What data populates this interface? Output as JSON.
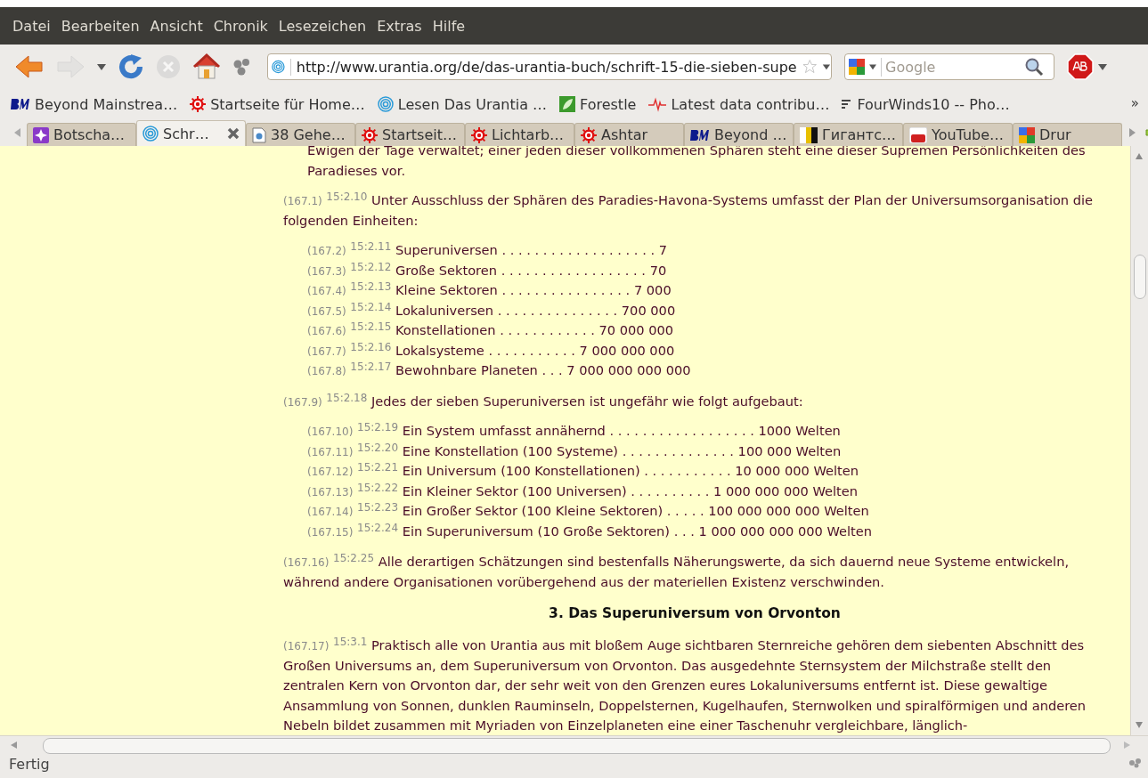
{
  "menu": [
    {
      "label": "Datei"
    },
    {
      "label": "Bearbeiten"
    },
    {
      "label": "Ansicht"
    },
    {
      "label": "Chronik"
    },
    {
      "label": "Lesezeichen"
    },
    {
      "label": "Extras"
    },
    {
      "label": "Hilfe"
    }
  ],
  "nav_buttons": [
    {
      "kind": "back",
      "disabled": false
    },
    {
      "kind": "forward",
      "disabled": true
    },
    {
      "kind": "history",
      "disabled": false
    },
    {
      "kind": "reload",
      "disabled": false
    },
    {
      "kind": "stop",
      "disabled": true
    },
    {
      "kind": "home",
      "disabled": false
    },
    {
      "kind": "addon",
      "disabled": false
    }
  ],
  "address_bar": {
    "value": "http://www.urantia.org/de/das-urantia-buch/schrift-15-die-sieben-supe"
  },
  "search": {
    "placeholder": "Google"
  },
  "bookmarks": [
    {
      "label": "Beyond Mainstrea…"
    },
    {
      "label": "Startseite für Home…"
    },
    {
      "label": "Lesen Das Urantia …"
    },
    {
      "label": "Forestle"
    },
    {
      "label": "Latest data contribu…"
    },
    {
      "label": "FourWinds10 -- Pho…"
    }
  ],
  "bookmarks_overflow": "»",
  "tabs": [
    {
      "label": "Botscha…",
      "selected": false
    },
    {
      "label": "Schr…",
      "selected": true
    },
    {
      "label": "38 Gehe…",
      "selected": false
    },
    {
      "label": "Startseit…",
      "selected": false
    },
    {
      "label": "Lichtarb…",
      "selected": false
    },
    {
      "label": "Ashtar",
      "selected": false
    },
    {
      "label": "Beyond …",
      "selected": false
    },
    {
      "label": "Гигантс…",
      "selected": false
    },
    {
      "label": "YouTube…",
      "selected": false
    },
    {
      "label": "Drur",
      "selected": false
    }
  ],
  "content": [
    {
      "kind": "continuation",
      "text": "Ewigen der Tage verwaltet; einer jeden dieser vollkommenen Sphären steht eine dieser Supremen Persönlichkeiten des Paradieses vor."
    },
    {
      "kind": "paragraph",
      "ref": "(167.1)",
      "verse": "15:2.10",
      "text": "Unter Ausschluss der Sphären des Paradies-Havona-Systems umfasst der Plan der Universumsorganisation die folgenden Einheiten:"
    },
    {
      "kind": "list",
      "items": [
        {
          "ref": "(167.2)",
          "verse": "15:2.11",
          "text": "Superuniversen . . . . . . . . . . . . . . . . . . . 7"
        },
        {
          "ref": "(167.3)",
          "verse": "15:2.12",
          "text": "Große Sektoren . . . . . . . . . . . . . . . . . . 70"
        },
        {
          "ref": "(167.4)",
          "verse": "15:2.13",
          "text": "Kleine Sektoren . . . . . . . . . . . . . . . . 7 000"
        },
        {
          "ref": "(167.5)",
          "verse": "15:2.14",
          "text": "Lokaluniversen . . . . . . . . . . . . . . . 700 000"
        },
        {
          "ref": "(167.6)",
          "verse": "15:2.15",
          "text": "Konstellationen . . . . . . . . . . . . 70 000 000"
        },
        {
          "ref": "(167.7)",
          "verse": "15:2.16",
          "text": "Lokalsysteme . . . . . . . . . . . 7 000 000 000"
        },
        {
          "ref": "(167.8)",
          "verse": "15:2.17",
          "text": "Bewohnbare Planeten . . . 7 000 000 000 000"
        }
      ]
    },
    {
      "kind": "paragraph",
      "ref": "(167.9)",
      "verse": "15:2.18",
      "text": "Jedes der sieben Superuniversen ist ungefähr wie folgt aufgebaut:"
    },
    {
      "kind": "list",
      "items": [
        {
          "ref": "(167.10)",
          "verse": "15:2.19",
          "text": "Ein System umfasst annähernd . . . . . . . . . . . . . . . . . . 1000 Welten"
        },
        {
          "ref": "(167.11)",
          "verse": "15:2.20",
          "text": "Eine Konstellation (100 Systeme) . . . . . . . . . . . . . . 100 000 Welten"
        },
        {
          "ref": "(167.12)",
          "verse": "15:2.21",
          "text": "Ein Universum (100 Konstellationen) . . . . . . . . . . . 10 000 000 Welten"
        },
        {
          "ref": "(167.13)",
          "verse": "15:2.22",
          "text": "Ein Kleiner Sektor (100 Universen) . . . . . . . . . . 1 000 000 000 Welten"
        },
        {
          "ref": "(167.14)",
          "verse": "15:2.23",
          "text": "Ein Großer Sektor (100 Kleine Sektoren) . . . . . 100 000 000 000 Welten"
        },
        {
          "ref": "(167.15)",
          "verse": "15:2.24",
          "text": "Ein Superuniversum (10 Große Sektoren) . . . 1 000 000 000 000 Welten"
        }
      ]
    },
    {
      "kind": "paragraph",
      "ref": "(167.16)",
      "verse": "15:2.25",
      "text": "Alle derartigen Schätzungen sind bestenfalls Näherungswerte, da sich dauernd neue Systeme entwickeln, während andere Organisationen vorübergehend aus der materiellen Existenz verschwinden."
    },
    {
      "kind": "heading",
      "text": "3. Das Superuniversum von Orvonton"
    },
    {
      "kind": "paragraph",
      "ref": "(167.17)",
      "verse": "15:3.1",
      "text": "Praktisch alle von Urantia aus mit bloßem Auge sichtbaren Sternreiche gehören dem siebenten Abschnitt des Großen Universums an, dem Superuniversum von Orvonton. Das ausgedehnte Sternsystem der Milchstraße stellt den zentralen Kern von Orvonton dar, der sehr weit von den Grenzen eures Lokaluniversums entfernt ist. Diese gewaltige Ansammlung von Sonnen, dunklen Rauminseln, Doppelsternen, Kugelhaufen, Sternwolken und spiralförmigen und anderen Nebeln bildet zusammen mit Myriaden von Einzelplaneten eine einer Taschenuhr vergleichbare, länglich-"
    }
  ],
  "status_bar": {
    "text": "Fertig"
  }
}
